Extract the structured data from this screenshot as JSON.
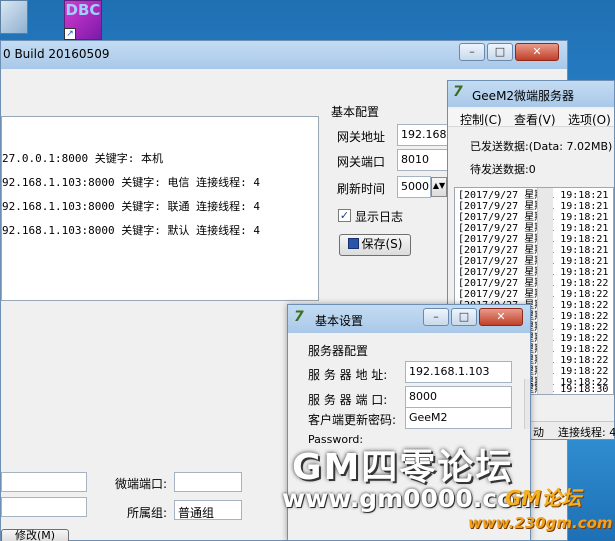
{
  "desktop": {
    "icon2_text": "DBC",
    "shortcut_glyph": "↗"
  },
  "main_window": {
    "title": "0 Build 20160509",
    "log_lines": [
      "27.0.0.1:8000 关键字: 本机",
      "92.168.1.103:8000 关键字: 电信 连接线程: 4",
      "92.168.1.103:8000 关键字: 联通 连接线程: 4",
      "92.168.1.103:8000 关键字: 默认 连接线程: 4"
    ],
    "basic_config": {
      "group_title": "基本配置",
      "gateway_addr_label": "网关地址",
      "gateway_addr_value": "192.168",
      "gateway_port_label": "网关端口",
      "gateway_port_value": "8010",
      "refresh_label": "刷新时间",
      "refresh_value": "5000",
      "show_log_label": "显示日志",
      "save_label": "保存(S)"
    },
    "bottom": {
      "port_label": "微端端口:",
      "group_label": "所属组:",
      "group_value": "普通组",
      "modify_label": "修改(M)"
    }
  },
  "geem2_window": {
    "title": "GeeM2微端服务器",
    "menu": [
      "控制(C)",
      "查看(V)",
      "选项(O)"
    ],
    "sent_label": "已发送数据:(Data: 7.02MB)",
    "pending_label": "待发送数据:0",
    "log_rows": [
      "[2017/9/27 星期三 19:18:21",
      "[2017/9/27 星期三 19:18:21",
      "[2017/9/27 星期三 19:18:21",
      "[2017/9/27 星期三 19:18:21",
      "[2017/9/27 星期三 19:18:21",
      "[2017/9/27 星期三 19:18:21",
      "[2017/9/27 星期三 19:18:21",
      "[2017/9/27 星期三 19:18:21",
      "[2017/9/27 星期三 19:18:22",
      "[2017/9/27 星期三 19:18:22",
      "[2017/9/27 星期三 19:18:22",
      "[2017/9/27 星期三 19:18:22",
      "[2017/9/27 星期三 19:18:22",
      "[2017/9/27 星期三 19:18:22",
      "[2017/9/27 星期三 19:18:22",
      "[2017/9/27 星期三 19:18:22",
      "[2017/9/27 星期三 19:18:22",
      "[2017/9/27 星期三 19:18:22",
      "[2017/9/27 星期三 19:18:30"
    ],
    "status_left": "动",
    "status_right": "连接线程: 4"
  },
  "settings_dialog": {
    "title": "基本设置",
    "group_title": "服务器配置",
    "server_addr_label": "服 务 器 地 址:",
    "server_addr_value": "192.168.1.103",
    "server_port_label": "服 务 器 端 口:",
    "server_port_value": "8000",
    "client_pwd_label": "客户端更新密码:",
    "client_pwd_value": "GeeM2",
    "password_label": "Password:"
  },
  "watermark": {
    "main": "GM四零论坛",
    "url": "www.gm0000.com",
    "url2": "www.230gm.com",
    "brand": "GM论坛"
  }
}
